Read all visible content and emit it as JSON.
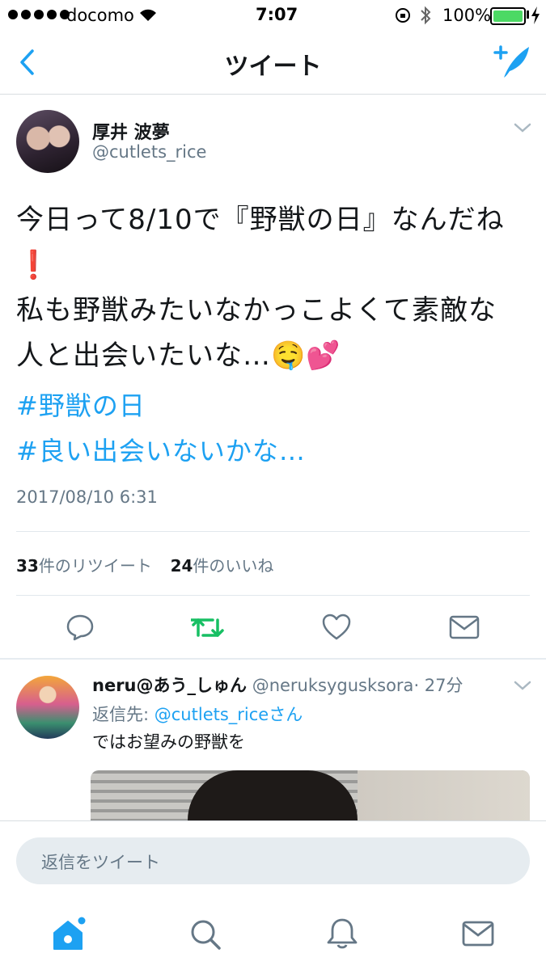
{
  "status_bar": {
    "carrier": "docomo",
    "time": "7:07",
    "battery": "100%"
  },
  "nav": {
    "title": "ツイート",
    "back_icon": "chevron-left-icon",
    "compose_icon": "compose-tweet-icon"
  },
  "tweet": {
    "display_name": "厚井 波夢",
    "username": "@cutlets_rice",
    "text_line1": "今日って8/10で『野獣の日』なんだね",
    "text_emoji1": "❗",
    "text_line2": "私も野獣みたいなかっこよくて素敵な",
    "text_line3": "人と出会いたいな…🤤💕",
    "hashtag1": "#野獣の日",
    "hashtag2": "#良い出会いないかな…",
    "timestamp": "2017/08/10 6:31",
    "retweet_count": "33",
    "retweet_label": "件のリツイート",
    "like_count": "24",
    "like_label": "件のいいね"
  },
  "reply": {
    "display_name": "neru@あう_しゅん",
    "username": "@neruksygusksora",
    "time": "· 27分",
    "reply_to_prefix": "返信先: ",
    "reply_to_user": "@cutlets_rice",
    "reply_to_suffix": "さん",
    "text": "ではお望みの野獣を"
  },
  "composer": {
    "placeholder": "返信をツイート"
  },
  "colors": {
    "accent": "#1da1f2",
    "retweet_green": "#17bf63",
    "battery_green": "#4cd964"
  }
}
